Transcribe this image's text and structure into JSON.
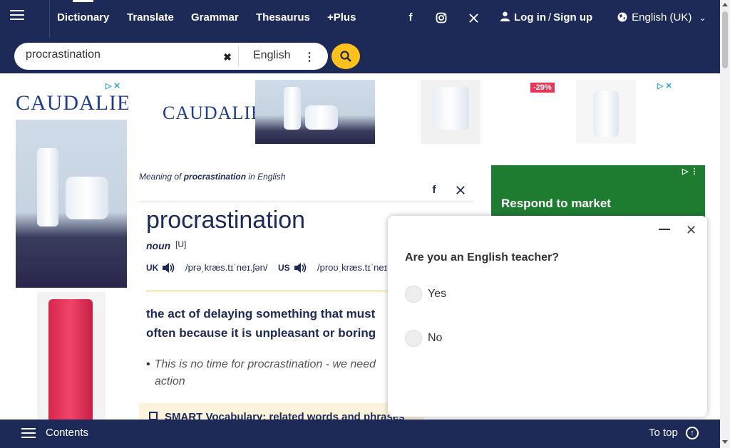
{
  "nav": {
    "links": [
      {
        "label": "Dictionary"
      },
      {
        "label": "Translate"
      },
      {
        "label": "Grammar"
      },
      {
        "label": "Thesaurus"
      },
      {
        "label": "+Plus"
      }
    ],
    "login": "Log in",
    "signup": "Sign up",
    "slash": "/",
    "language": "English (UK)"
  },
  "search": {
    "query": "procrastination",
    "dictionary": "English"
  },
  "ads": {
    "brand": "CAUDALIE",
    "discount": "-29%",
    "right_headline": "Respond to market"
  },
  "entry": {
    "meaning_prefix": "Meaning of",
    "meaning_word": "procrastination",
    "meaning_suffix": "in English",
    "headword": "procrastination",
    "pos": "noun",
    "grammar": "[U]",
    "uk_label": "UK",
    "uk_ipa": "/prəˌkræs.tɪˈneɪ.ʃən/",
    "us_label": "US",
    "us_ipa": "/proʊˌkræs.tɪˈneɪ.ʃən/",
    "definition": {
      "w1": "the",
      "w2": "act",
      "w3": "of",
      "w4": "delaying",
      "w5": "something that must",
      "w6": "often because it is",
      "w7": "unpleasant",
      "w8": "or",
      "w9": "boring"
    },
    "example": {
      "e1": "This is no",
      "e2": "time",
      "e3": "for procrastination - we need",
      "e4": "action"
    },
    "smart_vocab": "SMART Vocabulary: related words and phrases"
  },
  "survey": {
    "question": "Are you an English teacher?",
    "options": [
      "Yes",
      "No"
    ]
  },
  "bottom": {
    "contents": "Contents",
    "to_top": "To top"
  }
}
